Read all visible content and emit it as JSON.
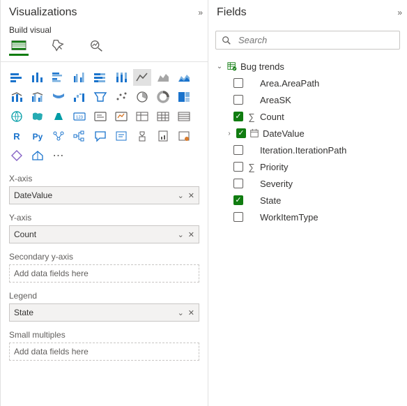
{
  "vis": {
    "title": "Visualizations",
    "subtitle": "Build visual",
    "wells": {
      "xaxis": {
        "label": "X-axis",
        "value": "DateValue"
      },
      "yaxis": {
        "label": "Y-axis",
        "value": "Count"
      },
      "sec_y": {
        "label": "Secondary y-axis",
        "placeholder": "Add data fields here"
      },
      "legend": {
        "label": "Legend",
        "value": "State"
      },
      "small_mult": {
        "label": "Small multiples",
        "placeholder": "Add data fields here"
      }
    }
  },
  "fields": {
    "title": "Fields",
    "search_placeholder": "Search",
    "table": "Bug trends",
    "items": [
      {
        "label": "Area.AreaPath",
        "checked": false,
        "icon": null
      },
      {
        "label": "AreaSK",
        "checked": false,
        "icon": null
      },
      {
        "label": "Count",
        "checked": true,
        "icon": "sigma"
      },
      {
        "label": "DateValue",
        "checked": true,
        "icon": "calendar",
        "expandable": true
      },
      {
        "label": "Iteration.IterationPath",
        "checked": false,
        "icon": null
      },
      {
        "label": "Priority",
        "checked": false,
        "icon": "sigma"
      },
      {
        "label": "Severity",
        "checked": false,
        "icon": null
      },
      {
        "label": "State",
        "checked": true,
        "icon": null
      },
      {
        "label": "WorkItemType",
        "checked": false,
        "icon": null
      }
    ]
  }
}
